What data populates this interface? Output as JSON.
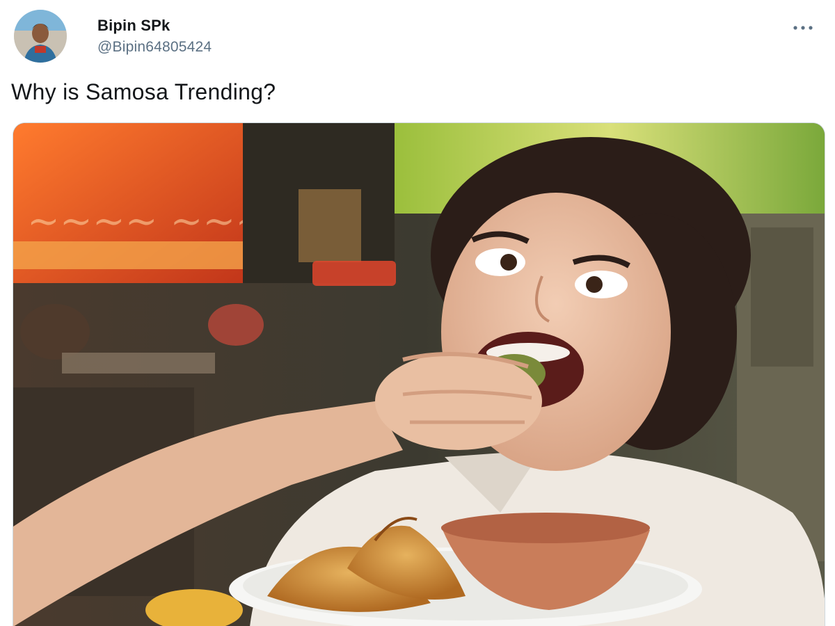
{
  "author": {
    "display_name": "Bipin SPk",
    "handle": "@Bipin64805424"
  },
  "tweet": {
    "text": "Why is Samosa Trending?"
  },
  "icons": {
    "more": "more-horizontal-icon"
  },
  "colors": {
    "name_text": "#14171a",
    "handle_text": "#5b7083",
    "border": "#cfd9de"
  }
}
